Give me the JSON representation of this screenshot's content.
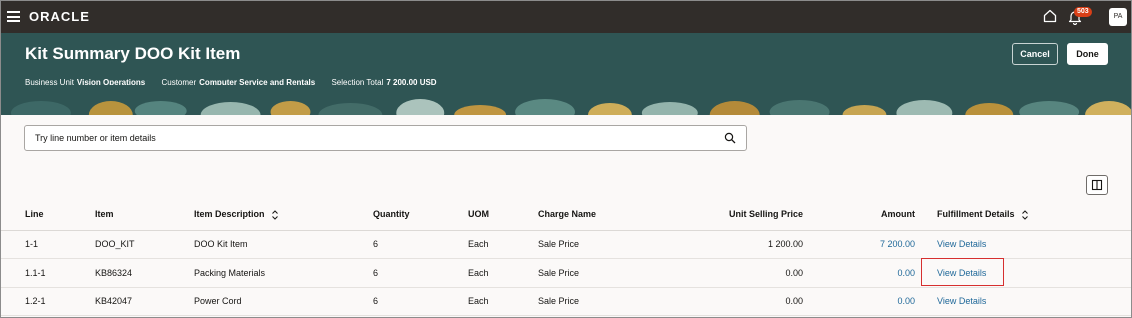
{
  "topbar": {
    "brand": "ORACLE",
    "notification_count": "503",
    "avatar_initials": "PA"
  },
  "header": {
    "title": "Kit Summary DOO Kit Item",
    "business_unit_label": "Business Unit",
    "business_unit_value": "Vision Operations",
    "customer_label": "Customer",
    "customer_value": "Computer Service and Rentals",
    "selection_total_label": "Selection Total",
    "selection_total_value": "7 200.00 USD",
    "cancel_label": "Cancel",
    "done_label": "Done"
  },
  "search": {
    "placeholder": "Try line number or item details"
  },
  "table": {
    "columns": [
      "Line",
      "Item",
      "Item Description",
      "Quantity",
      "UOM",
      "Charge Name",
      "Unit Selling Price",
      "Amount",
      "Fulfillment Details"
    ],
    "rows": [
      {
        "line": "1-1",
        "item": "DOO_KIT",
        "description": "DOO Kit Item",
        "quantity": "6",
        "uom": "Each",
        "charge": "Sale Price",
        "price": "1 200.00",
        "amount": "7 200.00",
        "details": "View Details"
      },
      {
        "line": "1.1-1",
        "item": "KB86324",
        "description": "Packing Materials",
        "quantity": "6",
        "uom": "Each",
        "charge": "Sale Price",
        "price": "0.00",
        "amount": "0.00",
        "details": "View Details"
      },
      {
        "line": "1.2-1",
        "item": "KB42047",
        "description": "Power Cord",
        "quantity": "6",
        "uom": "Each",
        "charge": "Sale Price",
        "price": "0.00",
        "amount": "0.00",
        "details": "View Details"
      }
    ]
  },
  "colors": {
    "topbar": "#312d2a",
    "header": "#2f5554",
    "link": "#1f6899",
    "highlight": "#d62f2f"
  }
}
